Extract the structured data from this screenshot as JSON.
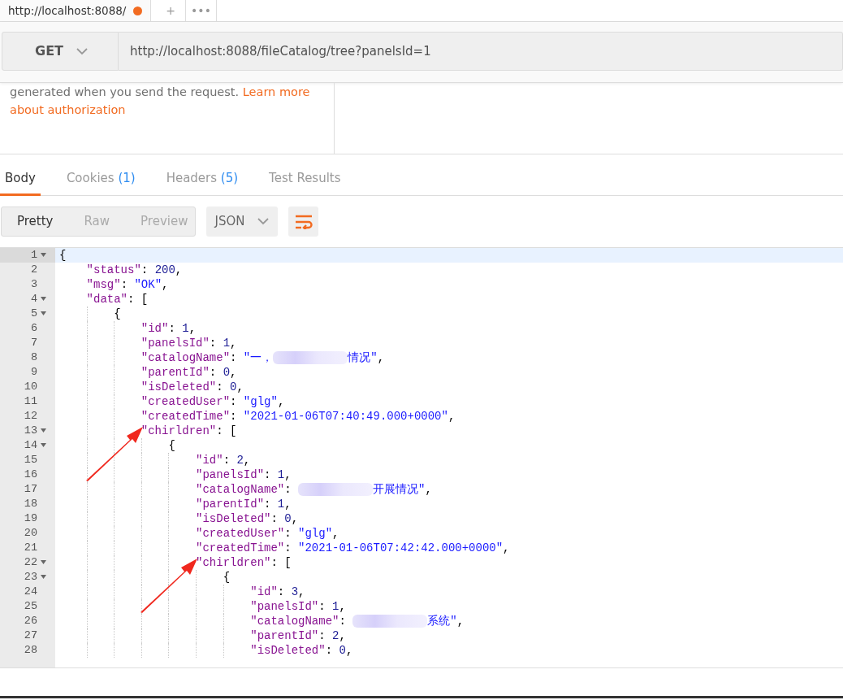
{
  "request_tabs": [
    {
      "label": "http://localhost:8088/",
      "selected": true,
      "unsaved": true
    }
  ],
  "tab_actions": [
    "+",
    "•••"
  ],
  "request": {
    "method": "GET",
    "url": "http://localhost:8088/fileCatalog/tree?panelsId=1"
  },
  "auth_help": {
    "text": "generated when you send the request.",
    "link": [
      "Learn more",
      "about authorization"
    ]
  },
  "response_tabs": [
    {
      "label": "Body",
      "selected": true
    },
    {
      "label": "Cookies",
      "count": "(1)",
      "selected": false
    },
    {
      "label": "Headers",
      "count": "(5)",
      "selected": false
    },
    {
      "label": "Test Results",
      "selected": false
    }
  ],
  "view_modes": [
    {
      "label": "Pretty",
      "selected": true
    },
    {
      "label": "Raw",
      "selected": false
    },
    {
      "label": "Preview",
      "selected": false
    }
  ],
  "format": "JSON",
  "editor": {
    "lines": [
      {
        "number": "1",
        "fold": true,
        "active": true,
        "tokens": [
          {
            "kind": "punct",
            "text": "{"
          }
        ]
      },
      {
        "number": "2",
        "tokens": [
          {
            "kind": "key",
            "text": "    \"status\""
          },
          {
            "kind": "punct",
            "text": ": "
          },
          {
            "kind": "number",
            "text": "200"
          },
          {
            "kind": "punct",
            "text": ","
          }
        ]
      },
      {
        "number": "3",
        "tokens": [
          {
            "kind": "key",
            "text": "    \"msg\""
          },
          {
            "kind": "punct",
            "text": ": "
          },
          {
            "kind": "string",
            "text": "\"OK\""
          },
          {
            "kind": "punct",
            "text": ","
          }
        ]
      },
      {
        "number": "4",
        "fold": true,
        "tokens": [
          {
            "kind": "key",
            "text": "    \"data\""
          },
          {
            "kind": "punct",
            "text": ": ["
          }
        ]
      },
      {
        "number": "5",
        "fold": true,
        "tokens": [
          {
            "kind": "punct",
            "text": "        {"
          }
        ]
      },
      {
        "number": "6",
        "tokens": [
          {
            "kind": "key",
            "text": "            \"id\""
          },
          {
            "kind": "punct",
            "text": ": "
          },
          {
            "kind": "number",
            "text": "1"
          },
          {
            "kind": "punct",
            "text": ","
          }
        ]
      },
      {
        "number": "7",
        "tokens": [
          {
            "kind": "key",
            "text": "            \"panelsId\""
          },
          {
            "kind": "punct",
            "text": ": "
          },
          {
            "kind": "number",
            "text": "1"
          },
          {
            "kind": "punct",
            "text": ","
          }
        ]
      },
      {
        "number": "8",
        "tokens": [
          {
            "kind": "key",
            "text": "            \"catalogName\""
          },
          {
            "kind": "punct",
            "text": ": "
          },
          {
            "kind": "string",
            "text": "\"一，"
          },
          {
            "kind": "blur"
          },
          {
            "kind": "string",
            "text": "情况\""
          },
          {
            "kind": "punct",
            "text": ","
          }
        ]
      },
      {
        "number": "9",
        "tokens": [
          {
            "kind": "key",
            "text": "            \"parentId\""
          },
          {
            "kind": "punct",
            "text": ": "
          },
          {
            "kind": "number",
            "text": "0"
          },
          {
            "kind": "punct",
            "text": ","
          }
        ]
      },
      {
        "number": "10",
        "tokens": [
          {
            "kind": "key",
            "text": "            \"isDeleted\""
          },
          {
            "kind": "punct",
            "text": ": "
          },
          {
            "kind": "number",
            "text": "0"
          },
          {
            "kind": "punct",
            "text": ","
          }
        ]
      },
      {
        "number": "11",
        "tokens": [
          {
            "kind": "key",
            "text": "            \"createdUser\""
          },
          {
            "kind": "punct",
            "text": ": "
          },
          {
            "kind": "string",
            "text": "\"glg\""
          },
          {
            "kind": "punct",
            "text": ","
          }
        ]
      },
      {
        "number": "12",
        "tokens": [
          {
            "kind": "key",
            "text": "            \"createdTime\""
          },
          {
            "kind": "punct",
            "text": ": "
          },
          {
            "kind": "string",
            "text": "\"2021-01-06T07:40:49.000+0000\""
          },
          {
            "kind": "punct",
            "text": ","
          }
        ]
      },
      {
        "number": "13",
        "fold": true,
        "marked": true,
        "tokens": [
          {
            "kind": "key",
            "text": "            \"chirldren\""
          },
          {
            "kind": "punct",
            "text": ": ["
          }
        ]
      },
      {
        "number": "14",
        "fold": true,
        "tokens": [
          {
            "kind": "punct",
            "text": "                {"
          }
        ]
      },
      {
        "number": "15",
        "tokens": [
          {
            "kind": "key",
            "text": "                    \"id\""
          },
          {
            "kind": "punct",
            "text": ": "
          },
          {
            "kind": "number",
            "text": "2"
          },
          {
            "kind": "punct",
            "text": ","
          }
        ]
      },
      {
        "number": "16",
        "tokens": [
          {
            "kind": "key",
            "text": "                    \"panelsId\""
          },
          {
            "kind": "punct",
            "text": ": "
          },
          {
            "kind": "number",
            "text": "1"
          },
          {
            "kind": "punct",
            "text": ","
          }
        ]
      },
      {
        "number": "17",
        "tokens": [
          {
            "kind": "key",
            "text": "                    \"catalogName\""
          },
          {
            "kind": "punct",
            "text": ": "
          },
          {
            "kind": "blur"
          },
          {
            "kind": "string",
            "text": "开展情况\""
          },
          {
            "kind": "punct",
            "text": ","
          }
        ]
      },
      {
        "number": "18",
        "tokens": [
          {
            "kind": "key",
            "text": "                    \"parentId\""
          },
          {
            "kind": "punct",
            "text": ": "
          },
          {
            "kind": "number",
            "text": "1"
          },
          {
            "kind": "punct",
            "text": ","
          }
        ]
      },
      {
        "number": "19",
        "tokens": [
          {
            "kind": "key",
            "text": "                    \"isDeleted\""
          },
          {
            "kind": "punct",
            "text": ": "
          },
          {
            "kind": "number",
            "text": "0"
          },
          {
            "kind": "punct",
            "text": ","
          }
        ]
      },
      {
        "number": "20",
        "tokens": [
          {
            "kind": "key",
            "text": "                    \"createdUser\""
          },
          {
            "kind": "punct",
            "text": ": "
          },
          {
            "kind": "string",
            "text": "\"glg\""
          },
          {
            "kind": "punct",
            "text": ","
          }
        ]
      },
      {
        "number": "21",
        "tokens": [
          {
            "kind": "key",
            "text": "                    \"createdTime\""
          },
          {
            "kind": "punct",
            "text": ": "
          },
          {
            "kind": "string",
            "text": "\"2021-01-06T07:42:42.000+0000\""
          },
          {
            "kind": "punct",
            "text": ","
          }
        ]
      },
      {
        "number": "22",
        "fold": true,
        "marked": true,
        "tokens": [
          {
            "kind": "key",
            "text": "                    \"chirldren\""
          },
          {
            "kind": "punct",
            "text": ": ["
          }
        ]
      },
      {
        "number": "23",
        "fold": true,
        "tokens": [
          {
            "kind": "punct",
            "text": "                        {"
          }
        ]
      },
      {
        "number": "24",
        "tokens": [
          {
            "kind": "key",
            "text": "                            \"id\""
          },
          {
            "kind": "punct",
            "text": ": "
          },
          {
            "kind": "number",
            "text": "3"
          },
          {
            "kind": "punct",
            "text": ","
          }
        ]
      },
      {
        "number": "25",
        "tokens": [
          {
            "kind": "key",
            "text": "                            \"panelsId\""
          },
          {
            "kind": "punct",
            "text": ": "
          },
          {
            "kind": "number",
            "text": "1"
          },
          {
            "kind": "punct",
            "text": ","
          }
        ]
      },
      {
        "number": "26",
        "tokens": [
          {
            "kind": "key",
            "text": "                            \"catalogName\""
          },
          {
            "kind": "punct",
            "text": ": "
          },
          {
            "kind": "blur"
          },
          {
            "kind": "string",
            "text": "系统\""
          },
          {
            "kind": "punct",
            "text": ","
          }
        ]
      },
      {
        "number": "27",
        "tokens": [
          {
            "kind": "key",
            "text": "                            \"parentId\""
          },
          {
            "kind": "punct",
            "text": ": "
          },
          {
            "kind": "number",
            "text": "2"
          },
          {
            "kind": "punct",
            "text": ","
          }
        ]
      },
      {
        "number": "28",
        "tokens": [
          {
            "kind": "key",
            "text": "                            \"isDeleted\""
          },
          {
            "kind": "punct",
            "text": ": "
          },
          {
            "kind": "number",
            "text": "0"
          },
          {
            "kind": "punct",
            "text": ","
          }
        ]
      }
    ]
  }
}
